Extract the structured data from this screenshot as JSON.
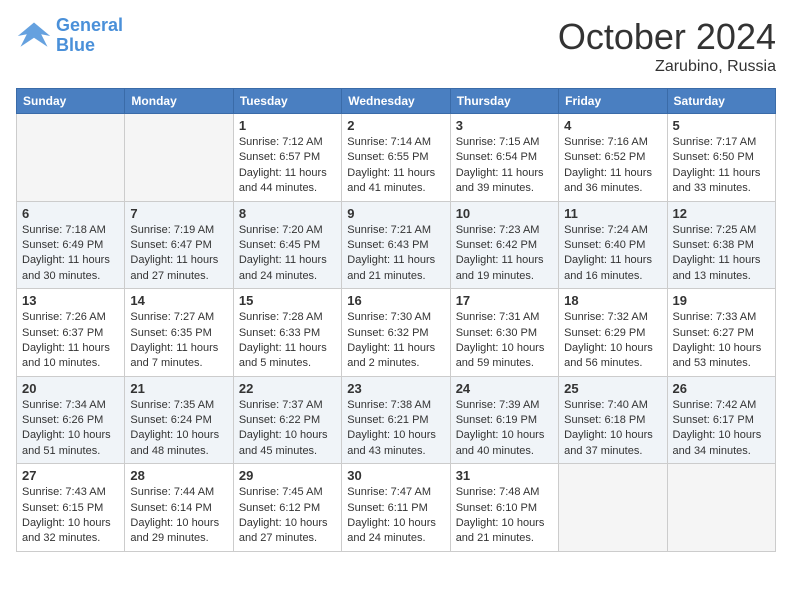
{
  "header": {
    "logo_line1": "General",
    "logo_line2": "Blue",
    "month": "October 2024",
    "location": "Zarubino, Russia"
  },
  "weekdays": [
    "Sunday",
    "Monday",
    "Tuesday",
    "Wednesday",
    "Thursday",
    "Friday",
    "Saturday"
  ],
  "weeks": [
    [
      {
        "day": "",
        "info": ""
      },
      {
        "day": "",
        "info": ""
      },
      {
        "day": "1",
        "info": "Sunrise: 7:12 AM\nSunset: 6:57 PM\nDaylight: 11 hours and 44 minutes."
      },
      {
        "day": "2",
        "info": "Sunrise: 7:14 AM\nSunset: 6:55 PM\nDaylight: 11 hours and 41 minutes."
      },
      {
        "day": "3",
        "info": "Sunrise: 7:15 AM\nSunset: 6:54 PM\nDaylight: 11 hours and 39 minutes."
      },
      {
        "day": "4",
        "info": "Sunrise: 7:16 AM\nSunset: 6:52 PM\nDaylight: 11 hours and 36 minutes."
      },
      {
        "day": "5",
        "info": "Sunrise: 7:17 AM\nSunset: 6:50 PM\nDaylight: 11 hours and 33 minutes."
      }
    ],
    [
      {
        "day": "6",
        "info": "Sunrise: 7:18 AM\nSunset: 6:49 PM\nDaylight: 11 hours and 30 minutes."
      },
      {
        "day": "7",
        "info": "Sunrise: 7:19 AM\nSunset: 6:47 PM\nDaylight: 11 hours and 27 minutes."
      },
      {
        "day": "8",
        "info": "Sunrise: 7:20 AM\nSunset: 6:45 PM\nDaylight: 11 hours and 24 minutes."
      },
      {
        "day": "9",
        "info": "Sunrise: 7:21 AM\nSunset: 6:43 PM\nDaylight: 11 hours and 21 minutes."
      },
      {
        "day": "10",
        "info": "Sunrise: 7:23 AM\nSunset: 6:42 PM\nDaylight: 11 hours and 19 minutes."
      },
      {
        "day": "11",
        "info": "Sunrise: 7:24 AM\nSunset: 6:40 PM\nDaylight: 11 hours and 16 minutes."
      },
      {
        "day": "12",
        "info": "Sunrise: 7:25 AM\nSunset: 6:38 PM\nDaylight: 11 hours and 13 minutes."
      }
    ],
    [
      {
        "day": "13",
        "info": "Sunrise: 7:26 AM\nSunset: 6:37 PM\nDaylight: 11 hours and 10 minutes."
      },
      {
        "day": "14",
        "info": "Sunrise: 7:27 AM\nSunset: 6:35 PM\nDaylight: 11 hours and 7 minutes."
      },
      {
        "day": "15",
        "info": "Sunrise: 7:28 AM\nSunset: 6:33 PM\nDaylight: 11 hours and 5 minutes."
      },
      {
        "day": "16",
        "info": "Sunrise: 7:30 AM\nSunset: 6:32 PM\nDaylight: 11 hours and 2 minutes."
      },
      {
        "day": "17",
        "info": "Sunrise: 7:31 AM\nSunset: 6:30 PM\nDaylight: 10 hours and 59 minutes."
      },
      {
        "day": "18",
        "info": "Sunrise: 7:32 AM\nSunset: 6:29 PM\nDaylight: 10 hours and 56 minutes."
      },
      {
        "day": "19",
        "info": "Sunrise: 7:33 AM\nSunset: 6:27 PM\nDaylight: 10 hours and 53 minutes."
      }
    ],
    [
      {
        "day": "20",
        "info": "Sunrise: 7:34 AM\nSunset: 6:26 PM\nDaylight: 10 hours and 51 minutes."
      },
      {
        "day": "21",
        "info": "Sunrise: 7:35 AM\nSunset: 6:24 PM\nDaylight: 10 hours and 48 minutes."
      },
      {
        "day": "22",
        "info": "Sunrise: 7:37 AM\nSunset: 6:22 PM\nDaylight: 10 hours and 45 minutes."
      },
      {
        "day": "23",
        "info": "Sunrise: 7:38 AM\nSunset: 6:21 PM\nDaylight: 10 hours and 43 minutes."
      },
      {
        "day": "24",
        "info": "Sunrise: 7:39 AM\nSunset: 6:19 PM\nDaylight: 10 hours and 40 minutes."
      },
      {
        "day": "25",
        "info": "Sunrise: 7:40 AM\nSunset: 6:18 PM\nDaylight: 10 hours and 37 minutes."
      },
      {
        "day": "26",
        "info": "Sunrise: 7:42 AM\nSunset: 6:17 PM\nDaylight: 10 hours and 34 minutes."
      }
    ],
    [
      {
        "day": "27",
        "info": "Sunrise: 7:43 AM\nSunset: 6:15 PM\nDaylight: 10 hours and 32 minutes."
      },
      {
        "day": "28",
        "info": "Sunrise: 7:44 AM\nSunset: 6:14 PM\nDaylight: 10 hours and 29 minutes."
      },
      {
        "day": "29",
        "info": "Sunrise: 7:45 AM\nSunset: 6:12 PM\nDaylight: 10 hours and 27 minutes."
      },
      {
        "day": "30",
        "info": "Sunrise: 7:47 AM\nSunset: 6:11 PM\nDaylight: 10 hours and 24 minutes."
      },
      {
        "day": "31",
        "info": "Sunrise: 7:48 AM\nSunset: 6:10 PM\nDaylight: 10 hours and 21 minutes."
      },
      {
        "day": "",
        "info": ""
      },
      {
        "day": "",
        "info": ""
      }
    ]
  ]
}
